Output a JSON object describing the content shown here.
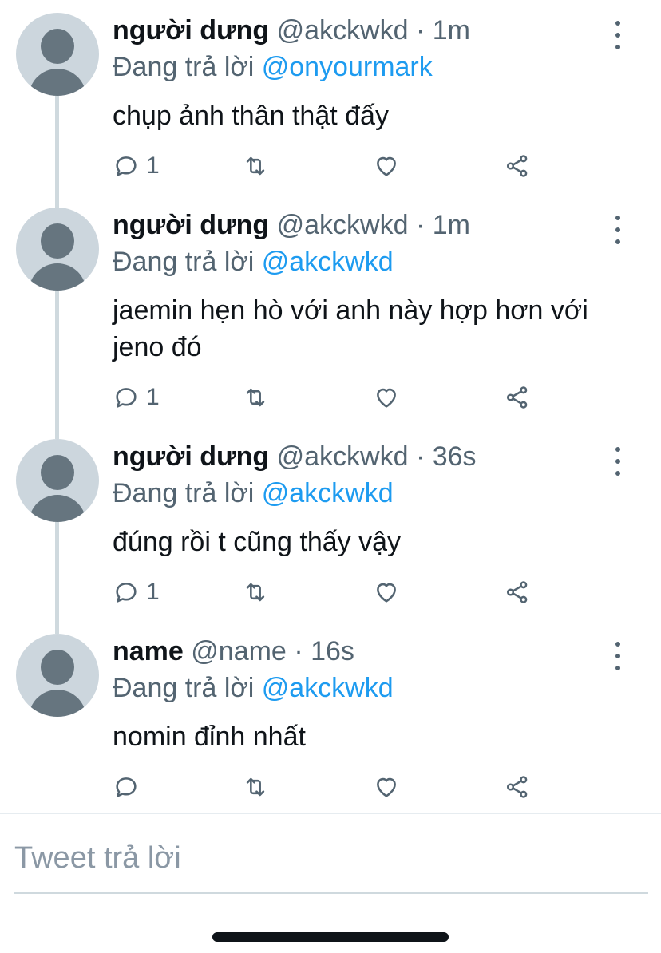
{
  "tweets": [
    {
      "display_name": "người dưng",
      "handle": "@akckwkd",
      "separator": "·",
      "time": "1m",
      "reply_prefix": "Đang trả lời",
      "reply_to": "@onyourmark",
      "text": "chụp ảnh thân thật đấy",
      "reply_count": "1"
    },
    {
      "display_name": "người dưng",
      "handle": "@akckwkd",
      "separator": "·",
      "time": "1m",
      "reply_prefix": "Đang trả lời",
      "reply_to": "@akckwkd",
      "text": "jaemin hẹn hò với anh này hợp hơn với jeno đó",
      "reply_count": "1"
    },
    {
      "display_name": "người dưng",
      "handle": "@akckwkd",
      "separator": "·",
      "time": "36s",
      "reply_prefix": "Đang trả lời",
      "reply_to": "@akckwkd",
      "text": "đúng rồi t cũng thấy vậy",
      "reply_count": "1"
    },
    {
      "display_name": "name",
      "handle": "@name",
      "separator": "·",
      "time": "16s",
      "reply_prefix": "Đang trả lời",
      "reply_to": "@akckwkd",
      "text": "nomin đỉnh nhất",
      "reply_count": ""
    }
  ],
  "reply_box": {
    "placeholder": "Tweet trả lời"
  },
  "icons": {
    "reply": "reply-icon",
    "retweet": "retweet-icon",
    "like": "like-icon",
    "share": "share-icon",
    "more": "more-options-icon",
    "avatar": "default-avatar-icon"
  },
  "colors": {
    "link": "#1d9bf0",
    "secondary_text": "#536471",
    "thread_line": "#cfd9de",
    "avatar_bg": "#ccd6dd",
    "avatar_fg": "#66757f"
  }
}
